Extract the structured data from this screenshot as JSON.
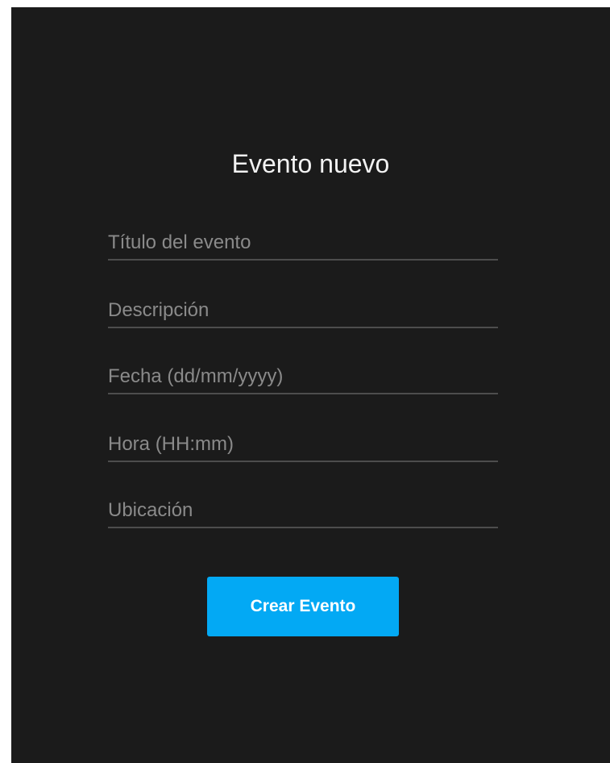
{
  "form": {
    "title": "Evento nuevo",
    "fields": [
      {
        "placeholder": "Título del evento",
        "value": ""
      },
      {
        "placeholder": "Descripción",
        "value": ""
      },
      {
        "placeholder": "Fecha (dd/mm/yyyy)",
        "value": ""
      },
      {
        "placeholder": "Hora (HH:mm)",
        "value": ""
      },
      {
        "placeholder": "Ubicación",
        "value": ""
      }
    ],
    "submit_label": "Crear Evento"
  },
  "colors": {
    "background": "#1b1b1b",
    "accent": "#03a9f4",
    "title_text": "#f2f2f2",
    "placeholder_text": "#8a8a8a",
    "underline": "#4d4d4d"
  }
}
